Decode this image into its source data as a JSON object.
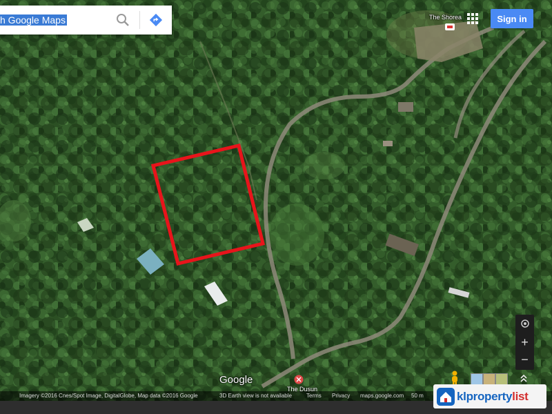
{
  "search": {
    "query": "h Google Maps"
  },
  "header": {
    "signin_label": "Sign in"
  },
  "places": {
    "shorea": "The Shorea",
    "dusun": "The Dusun"
  },
  "logo": "Google",
  "attribution": {
    "imagery": "Imagery ©2016 Cnes/Spot Image, DigitalGlobe, Map data ©2016 Google",
    "earth": "3D Earth view is not available",
    "terms": "Terms",
    "privacy": "Privacy",
    "site": "maps.google.com",
    "cm": "50 m"
  },
  "controls": {
    "zoom_in": "+",
    "zoom_out": "−"
  },
  "watermark": {
    "brand_main": "klproperty",
    "brand_accent": "list"
  },
  "colors": {
    "highlight_box": "#e8141b",
    "signin": "#4a8af4",
    "search_highlight": "#3a7bd5"
  }
}
